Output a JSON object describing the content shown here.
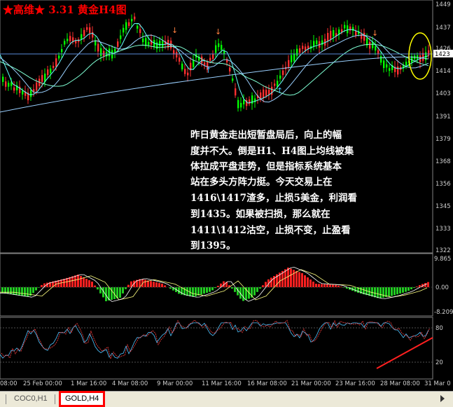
{
  "title": "★高维★  3.31  黄金H4图",
  "commentary_lines": [
    "昨日黄金走出短暂盘局后，向上的幅",
    "度并不大。倒是H1、H4图上均线被集",
    "体拉成平盘走势，但是指标系统基本",
    "站在多头方阵力挺。今天交易上在",
    "1416\\1417渣多，止损5美金，利润看",
    "到1435。如果被扫损，那么就在",
    "1411\\1412沽空，止损不变，止盈看",
    "到1395。"
  ],
  "price_axis": {
    "ticks": [
      "1449",
      "1437",
      "1426",
      "1414",
      "1403",
      "1391",
      "1379",
      "1368",
      "1356",
      "1345",
      "1333",
      "1322"
    ],
    "current_price": "1423"
  },
  "macd_axis": {
    "ticks": [
      "9.865",
      "0.00",
      "-8.209"
    ]
  },
  "stoch_axis": {
    "ticks": [
      "80",
      "20"
    ]
  },
  "time_axis": {
    "labels": [
      "08:00",
      "25 Feb 00:00",
      "1 Mar 16:00",
      "4 Mar 08:00",
      "9 Mar 00:00",
      "11 Mar 16:00",
      "16 Mar 08:00",
      "21 Mar 00:00",
      "23 Mar 16:00",
      "28 Mar 08:00",
      "31 Mar 0"
    ]
  },
  "tabs": [
    {
      "label": "COC0,H1",
      "active": false
    },
    {
      "label": "GOLD,H4",
      "active": true
    }
  ],
  "colors": {
    "background": "#000000",
    "bull": "#00ff00",
    "bear": "#ff3030",
    "ma_fast": "#66ffff",
    "ma_mid": "#9ad0ff",
    "ma_slow": "#7fffd4",
    "macd_pos": "#ff2020",
    "macd_neg": "#22cc22",
    "signal": "#ffff80",
    "text_white": "#ffffff",
    "title_red": "#ff0000",
    "ellipse": "#ffff00"
  }
}
